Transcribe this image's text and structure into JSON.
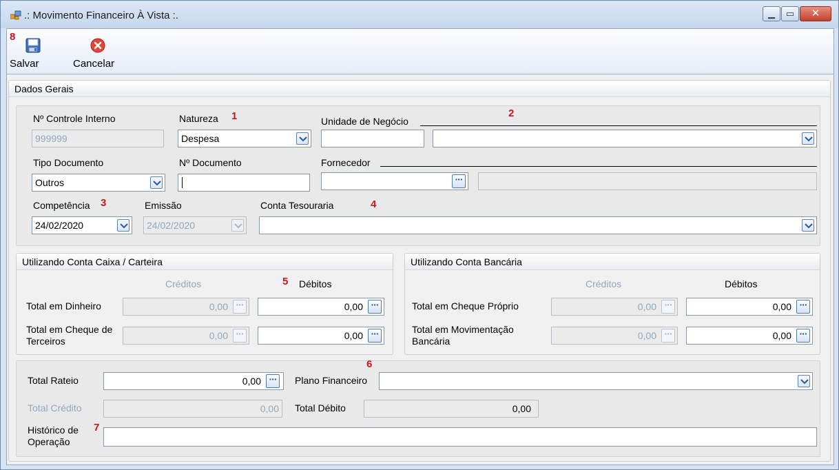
{
  "window": {
    "title": ".: Movimento Financeiro À Vista :.",
    "minimize_glyph": "▁",
    "maximize_glyph": "▭",
    "close_glyph": "✕"
  },
  "toolbar": {
    "save_label": "Salvar",
    "cancel_label": "Cancelar",
    "save_icon": "floppy-disk-icon",
    "cancel_icon": "red-x-circle-icon"
  },
  "annotations": [
    "1",
    "2",
    "3",
    "4",
    "5",
    "6",
    "7",
    "8"
  ],
  "dados_gerais": {
    "header": "Dados Gerais",
    "controle_label": "Nº Controle Interno",
    "controle_value": "999999",
    "natureza_label": "Natureza",
    "natureza_value": "Despesa",
    "unidade_label": "Unidade de Negócio",
    "unidade_code": "",
    "unidade_name": "",
    "tipo_doc_label": "Tipo Documento",
    "tipo_doc_value": "Outros",
    "num_doc_label": "Nº Documento",
    "num_doc_value": "",
    "fornecedor_label": "Fornecedor",
    "fornecedor_code": "",
    "fornecedor_name": "",
    "competencia_label": "Competência",
    "competencia_value": "24/02/2020",
    "emissao_label": "Emissão",
    "emissao_value": "24/02/2020",
    "conta_tes_label": "Conta Tesouraria",
    "conta_tes_value": ""
  },
  "caixa": {
    "header": "Utilizando Conta Caixa / Carteira",
    "creditos_header": "Créditos",
    "debitos_header": "Débitos",
    "rows": [
      {
        "label": "Total em Dinheiro",
        "credito": "0,00",
        "debito": "0,00"
      },
      {
        "label": "Total em Cheque de Terceiros",
        "credito": "0,00",
        "debito": "0,00"
      }
    ]
  },
  "bancaria": {
    "header": "Utilizando Conta Bancária",
    "creditos_header": "Créditos",
    "debitos_header": "Débitos",
    "rows": [
      {
        "label": "Total em Cheque Próprio",
        "credito": "0,00",
        "debito": "0,00"
      },
      {
        "label": "Total em Movimentação Bancária",
        "credito": "0,00",
        "debito": "0,00"
      }
    ]
  },
  "totais": {
    "rateio_label": "Total Rateio",
    "rateio_value": "0,00",
    "plano_label": "Plano Financeiro",
    "plano_value": "",
    "credito_label": "Total Crédito",
    "credito_value": "0,00",
    "debito_label": "Total Débito",
    "debito_value": "0,00",
    "historico_label": "Histórico de Operação",
    "historico_value": ""
  },
  "colors": {
    "annotation": "#d0141a",
    "dim_text": "#8fa8c0",
    "accent_border": "#4d79bb"
  }
}
